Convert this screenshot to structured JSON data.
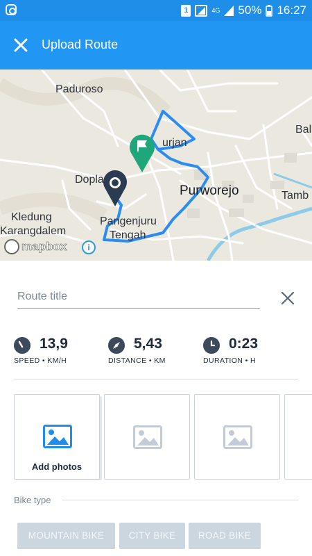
{
  "status_bar": {
    "network": "4G",
    "sim_slot": "1",
    "battery": "50%",
    "time": "16:27",
    "icons": [
      "instagram-icon",
      "sim-icon",
      "signal-icon",
      "battery-icon"
    ]
  },
  "app_bar": {
    "title": "Upload Route",
    "close_icon": "close-icon"
  },
  "map": {
    "labels": [
      "Paduroso",
      "Bal",
      "urjan",
      "Dopla",
      "Purworejo",
      "Tamb",
      "Kledung",
      "Karangdalem",
      "Pangenjuru",
      "Tengah"
    ],
    "logo": "mapbox",
    "route_color": "#2d8cf0",
    "start_pin_color": "#2a3b52",
    "finish_pin_color": "#1fa67a"
  },
  "form": {
    "title_placeholder": "Route title",
    "title_value": ""
  },
  "stats": [
    {
      "icon": "speedometer-icon",
      "value": "13,9",
      "label": "SPEED • KM/H"
    },
    {
      "icon": "compass-icon",
      "value": "5,43",
      "label": "DISTANCE • KM"
    },
    {
      "icon": "clock-icon",
      "value": "0:23",
      "label": "DURATION • H"
    }
  ],
  "photos": {
    "add_label": "Add photos",
    "accent": "#1f8ee8",
    "placeholder_color": "#c3ccd6"
  },
  "bike_type": {
    "label": "Bike type",
    "options": [
      "MOUNTAIN BIKE",
      "CITY BIKE",
      "ROAD BIKE"
    ]
  }
}
